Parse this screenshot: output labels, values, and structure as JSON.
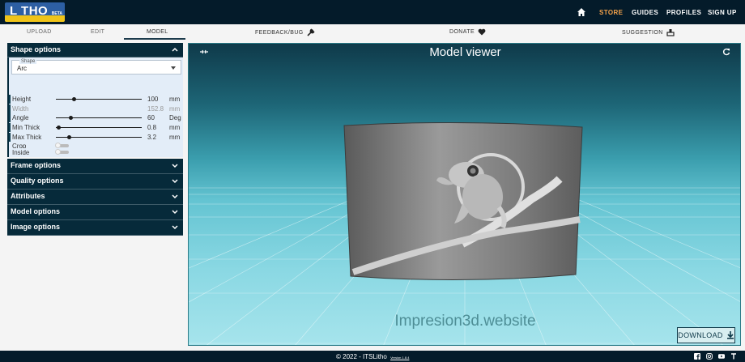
{
  "header": {
    "logo_text": "L THO",
    "logo_tag": "BETA",
    "nav": [
      {
        "label": "STORE",
        "color": "#f4a24a"
      },
      {
        "label": "GUIDES",
        "color": "#ffffff"
      },
      {
        "label": "PROFILES",
        "color": "#ffffff"
      },
      {
        "label": "SIGN UP",
        "color": "#ffffff"
      }
    ]
  },
  "tabs": {
    "upload": "UPLOAD",
    "edit": "EDIT",
    "model": "MODEL",
    "feedback": "FEEDBACK/BUG",
    "donate": "DONATE",
    "suggestion": "SUGGESTION"
  },
  "panel": {
    "shape_options": "Shape options",
    "shape_label": "Shape",
    "shape_value": "Arc",
    "fields": [
      {
        "name": "Height",
        "value": "100",
        "unit": "mm",
        "fraction": 0.22,
        "enabled": true
      },
      {
        "name": "Width",
        "value": "152.8",
        "unit": "mm",
        "enabled": false
      },
      {
        "name": "Angle",
        "value": "60",
        "unit": "Deg",
        "fraction": 0.17,
        "enabled": true
      },
      {
        "name": "Min Thick",
        "value": "0.8",
        "unit": "mm",
        "fraction": 0.0,
        "enabled": true
      },
      {
        "name": "Max Thick",
        "value": "3.2",
        "unit": "mm",
        "fraction": 0.15,
        "enabled": true
      }
    ],
    "toggles": [
      {
        "name": "Crop",
        "on": false
      },
      {
        "name": "Inside",
        "on": false
      }
    ],
    "sections": [
      "Frame options",
      "Quality options",
      "Attributes",
      "Model options",
      "Image options"
    ]
  },
  "viewer": {
    "title": "Model viewer",
    "watermark": "Impresion3d.website",
    "download": "DOWNLOAD"
  },
  "footer": {
    "copyright": "© 2022 - ITSLitho",
    "version": "Version 1.8.4"
  }
}
